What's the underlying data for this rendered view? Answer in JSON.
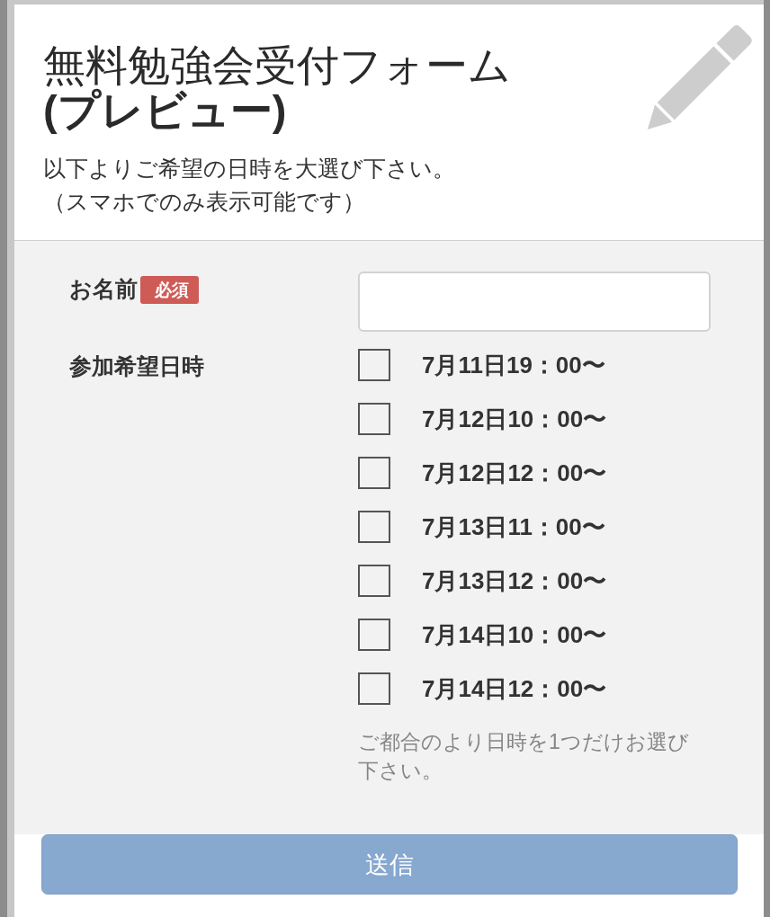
{
  "header": {
    "title": "無料勉強会受付フォーム\n**(プレビュー)**",
    "description": [
      "以下よりご希望の日時を大選び下さい。",
      "（スマホでのみ表示可能です）"
    ]
  },
  "fields": [
    {
      "kind": "text",
      "label": "お名前",
      "badge": "必須"
    },
    {
      "kind": "checkboxes",
      "label": "参加希望日時",
      "options": [
        {
          "label": "7月11日19：00〜",
          "checked": false
        },
        {
          "label": "7月12日10：00〜",
          "checked": false
        },
        {
          "label": "7月12日12：00〜",
          "checked": false
        },
        {
          "label": "7月13日11：00〜",
          "checked": false
        },
        {
          "label": "7月13日12：00〜",
          "checked": false
        },
        {
          "label": "7月14日10：00〜",
          "checked": false
        },
        {
          "label": "7月14日12：00〜",
          "checked": false
        }
      ],
      "help": "ご都合のより日時を1つだけお選び下さい。"
    }
  ],
  "submit_button": {
    "label": "送信"
  }
}
